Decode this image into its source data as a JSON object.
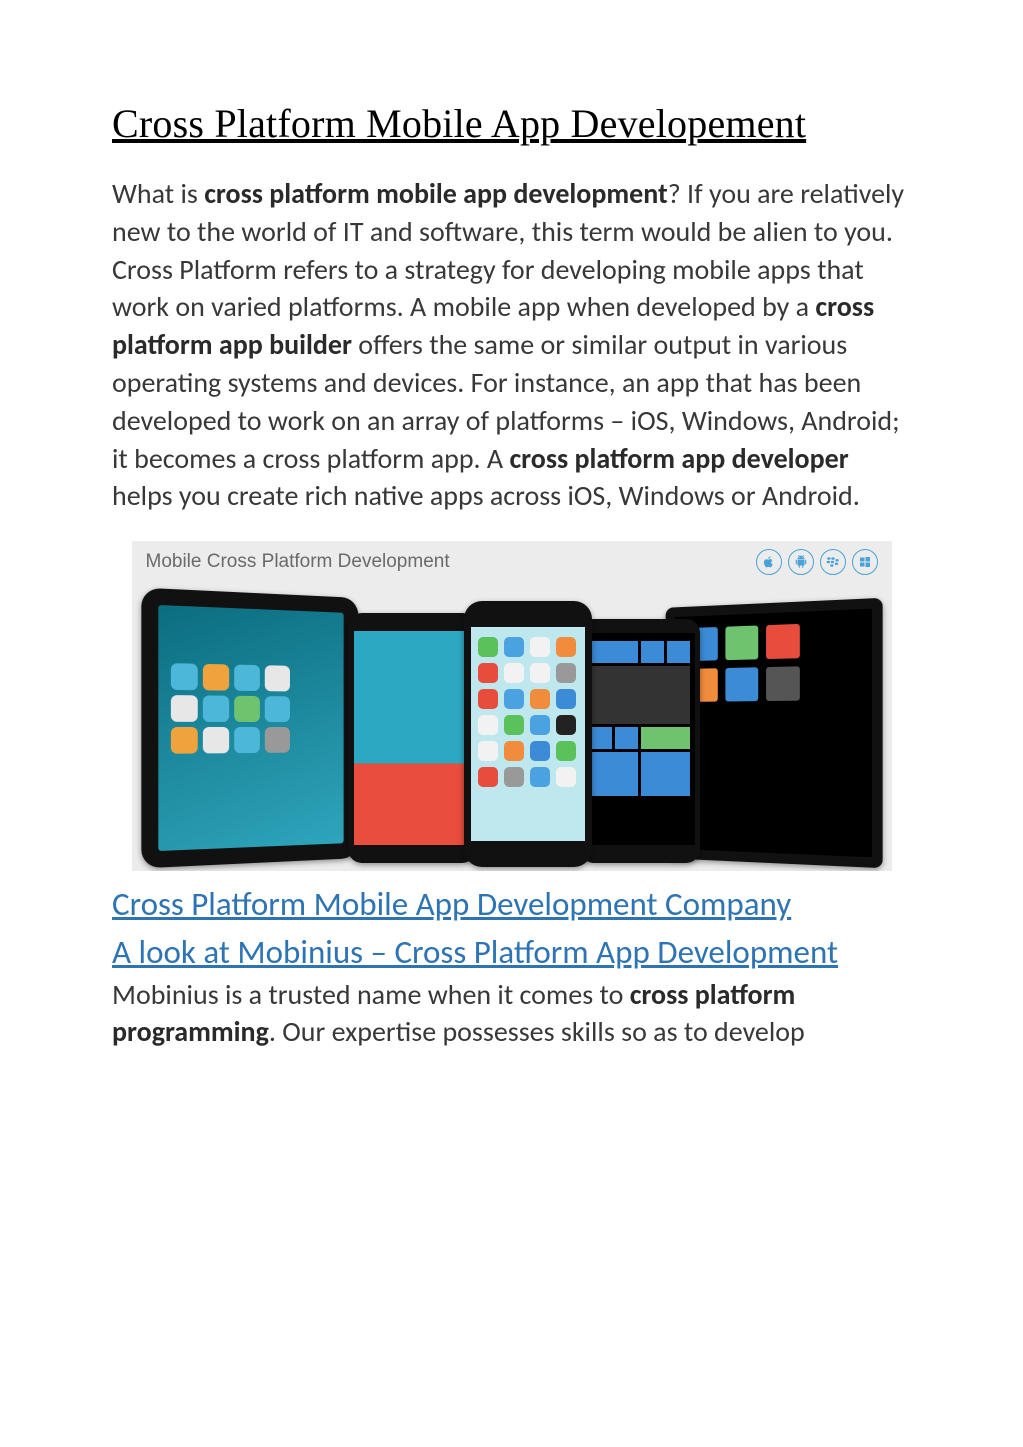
{
  "title": "Cross Platform Mobile App Developement",
  "p1": {
    "t1": "What is ",
    "b1": "cross platform mobile app development",
    "t2": "? If you are relatively new to the world of IT and software, this term would be alien to you. Cross Platform refers to a strategy for developing mobile apps that work on varied platforms. A mobile app when developed by a ",
    "b2": "cross platform app builder",
    "t3": " offers the same or similar output in various operating systems and devices. For instance, an app that has been developed to work on an array of platforms – iOS, Windows, Android; it becomes a cross platform app. A ",
    "b3": "cross platform app developer",
    "t4": " helps you create rich native apps across iOS, Windows or Android."
  },
  "figure_caption": "Mobile Cross Platform Development",
  "os_icons": [
    "apple-icon",
    "android-icon",
    "blackberry-icon",
    "windows-icon"
  ],
  "link1": "Cross Platform Mobile App Development Company",
  "link2": "A look at Mobinius – Cross Platform App Development",
  "p2": {
    "t1": "Mobinius is a trusted name when it comes to ",
    "b1": "cross platform programming",
    "t2": ". Our expertise possesses skills so as to develop"
  }
}
